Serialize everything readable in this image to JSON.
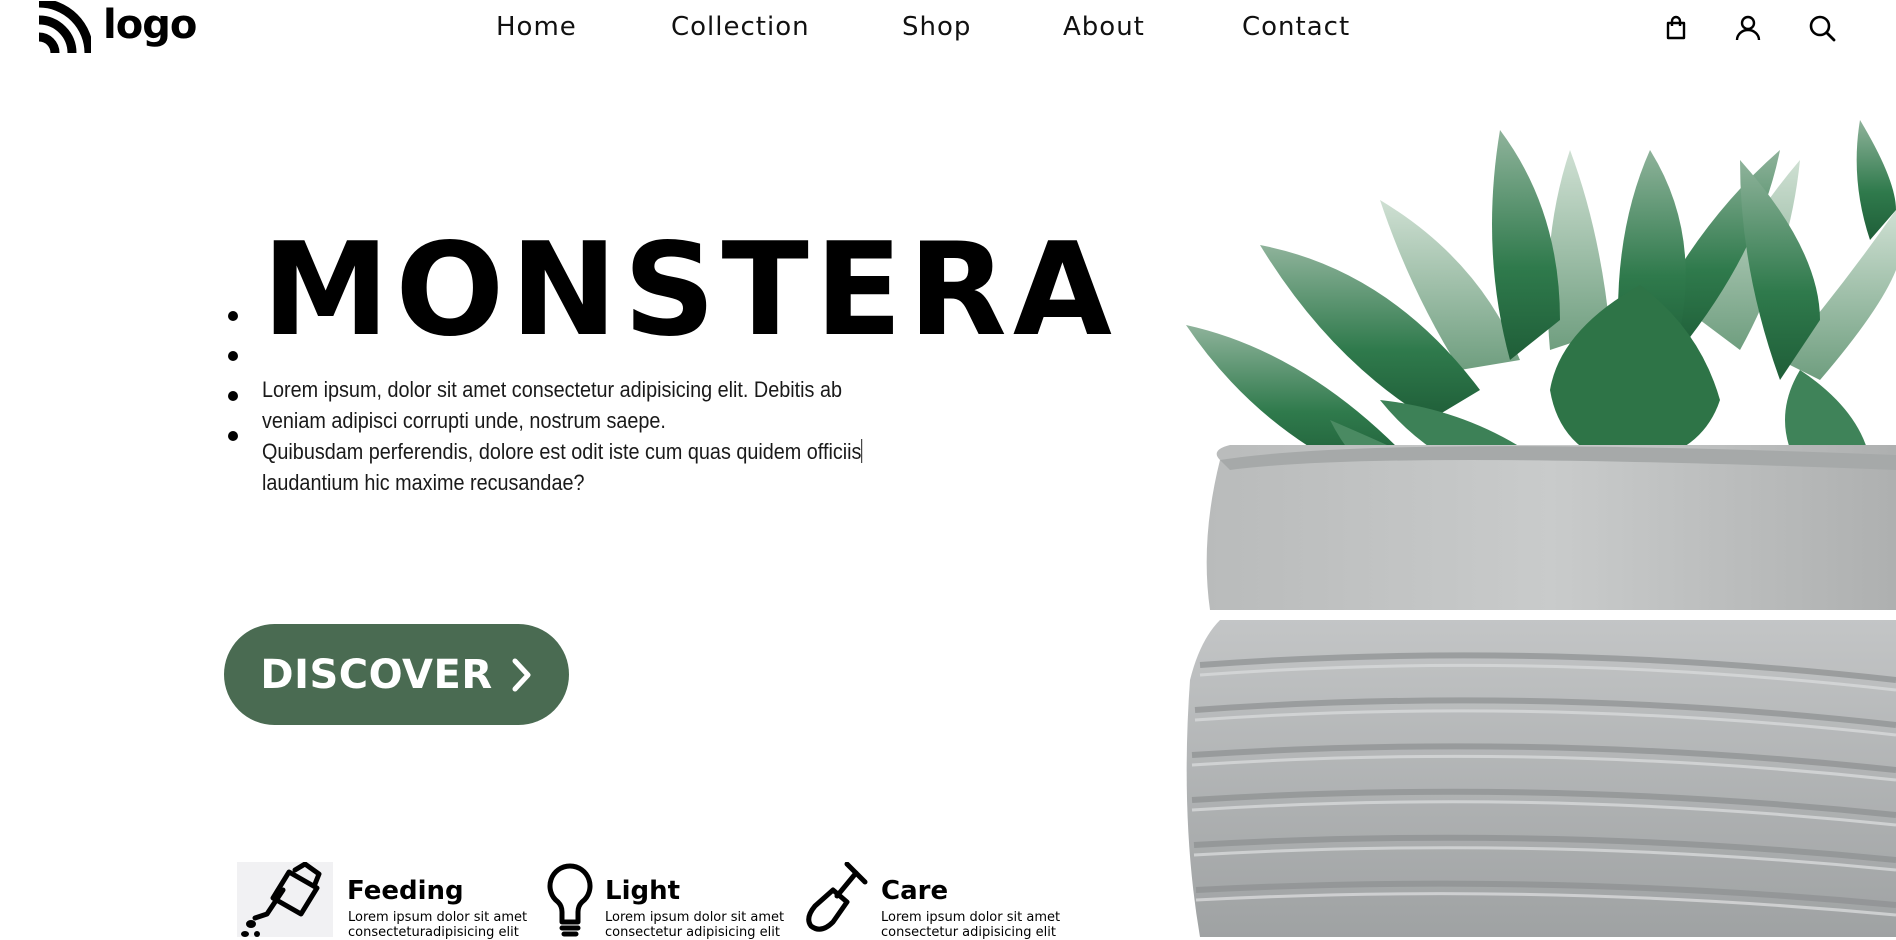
{
  "header": {
    "logo_text": "logo",
    "nav": [
      "Home",
      "Collection",
      "Shop",
      "About",
      "Contact"
    ],
    "icons": [
      "shopping-bag-icon",
      "user-icon",
      "search-icon"
    ]
  },
  "hero": {
    "title": "MONSTERA",
    "description_line1": "Lorem ipsum, dolor sit amet consectetur adipisicing elit. Debitis ab",
    "description_line2": "veniam adipisci corrupti unde, nostrum saepe.",
    "description_line3": "Quibusdam perferendis, dolore est odit iste cum quas quidem officiis",
    "description_line4": "laudantium hic maxime recusandae?",
    "cta_label": "DISCOVER",
    "accent_color": "#4a6b52"
  },
  "features": [
    {
      "title": "Feeding",
      "line1": "Lorem ipsum dolor sit amet",
      "line2": "consecteturadipisicing elit",
      "icon": "watering-can-icon"
    },
    {
      "title": "Light",
      "line1": "Lorem ipsum dolor sit amet",
      "line2": "consectetur adipisicing elit",
      "icon": "light-bulb-icon"
    },
    {
      "title": "Care",
      "line1": "Lorem ipsum dolor sit amet",
      "line2": "consectetur adipisicing elit",
      "icon": "shovel-icon"
    }
  ],
  "image": {
    "subject": "succulent-in-concrete-pot"
  }
}
